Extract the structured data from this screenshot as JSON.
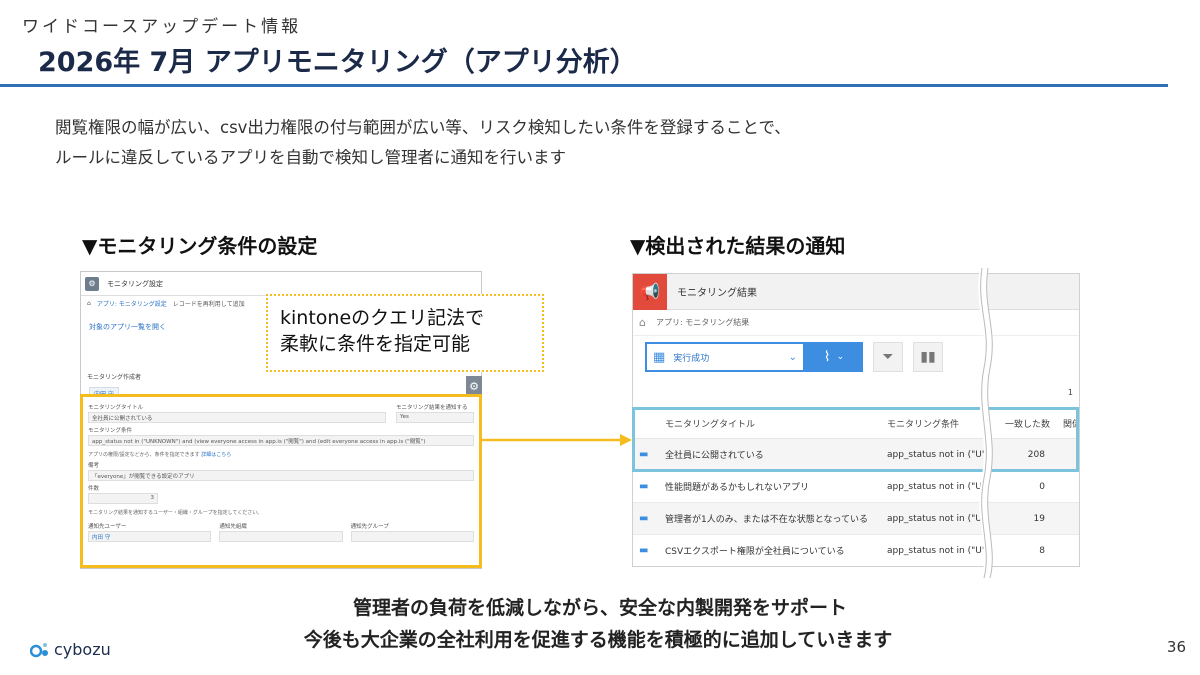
{
  "header": {
    "eyebrow": "ワイドコースアップデート情報",
    "title": "2026年 7月 アプリモニタリング（アプリ分析）"
  },
  "intro": {
    "line1": "閲覧権限の幅が広い、csv出力権限の付与範囲が広い等、リスク検知したい条件を登録することで、",
    "line2": "ルールに違反しているアプリを自動で検知し管理者に通知を行います"
  },
  "left_section": {
    "title": "▼モニタリング条件の設定",
    "screenshot": {
      "window_title": "モニタリング設定",
      "breadcrumb": [
        "アプリ: モニタリング設定",
        "レコードを再利用して追加"
      ],
      "link": "対象のアプリ一覧を開く",
      "creator_label": "モニタリング作成者",
      "creator_value": "内田 守",
      "title_label": "モニタリングタイトル",
      "title_value": "全社員に公開されている",
      "notify_label": "モニタリング結果を通知する",
      "notify_value": "Yes",
      "condition_label": "モニタリング条件",
      "condition_value": "app_status not in (\"UNKNOWN\") and (view everyone access in app.is (\"閲覧\") and (edit everyone access in app.is (\"閲覧\")",
      "condition_note": "アプリの権限/設定などから、条件を指定できます",
      "condition_note_link": "詳細はこちら",
      "memo_label": "備考",
      "memo_value": "「everyone」が閲覧できる設定のアプリ",
      "count_label": "件数",
      "count_value": "3",
      "footer_note": "モニタリング結果を通知するユーザー・組織・グループを指定してください。",
      "notify_user_label": "通知先ユーザー",
      "notify_user_value": "内田 守",
      "notify_org_label": "通知先組織",
      "notify_group_label": "通知先グループ"
    },
    "callout_line1": "kintoneのクエリ記法で",
    "callout_line2": "柔軟に条件を指定可能"
  },
  "right_section": {
    "title": "▼検出された結果の通知",
    "screenshot": {
      "window_title": "モニタリング結果",
      "breadcrumb": "アプリ: モニタリング結果",
      "view_select": "実行成功",
      "page_indicator": "1",
      "columns": [
        "モニタリングタイトル",
        "モニタリング条件",
        "一致した数",
        "関係"
      ],
      "rows": [
        {
          "title": "全社員に公開されている",
          "condition": "app_status not in (\"U\"",
          "count": "208"
        },
        {
          "title": "性能問題があるかもしれないアプリ",
          "condition": "app_status not in (\"U\"",
          "count": "0"
        },
        {
          "title": "管理者が1人のみ、または不在な状態となっている",
          "condition": "app_status not in (\"U\"",
          "count": "19"
        },
        {
          "title": "CSVエクスポート権限が全社員についている",
          "condition": "app_status not in (\"U\"",
          "count": "8"
        }
      ]
    }
  },
  "footer": {
    "message1": "管理者の負荷を低減しながら、安全な内製開発をサポート",
    "message2": "今後も大企業の全社利用を促進する機能を積極的に追加していきます",
    "logo": "cybozu",
    "page_number": "36"
  },
  "colors": {
    "title_rule": "#2f6fb4",
    "highlight_yellow": "#f4bc1e",
    "highlight_blue": "#7cc4de",
    "accent_blue": "#3d8ee0",
    "app_red": "#e24a3b"
  }
}
